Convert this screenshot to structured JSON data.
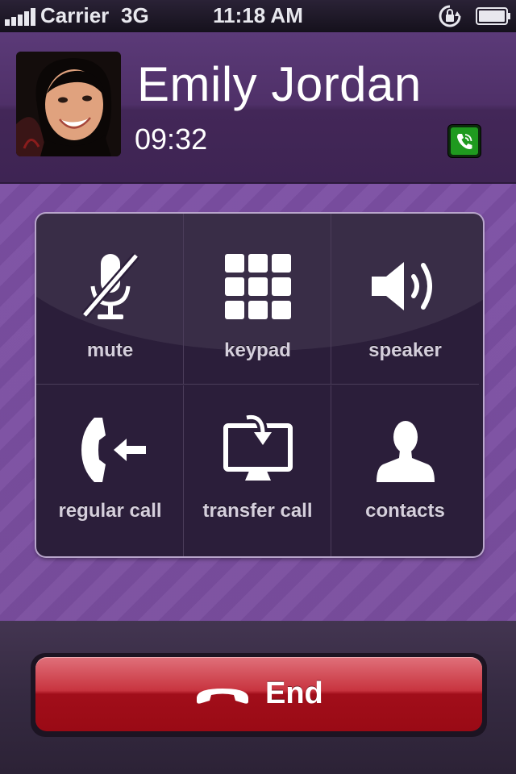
{
  "status_bar": {
    "carrier": "Carrier",
    "network": "3G",
    "time": "11:18 AM",
    "icons": [
      "signal-icon",
      "rotation-lock-icon",
      "battery-icon"
    ]
  },
  "caller": {
    "name": "Emily Jordan",
    "duration": "09:32",
    "badge_icon": "viber-phone-icon"
  },
  "controls": [
    {
      "label": "mute",
      "icon": "mute-icon"
    },
    {
      "label": "keypad",
      "icon": "keypad-icon"
    },
    {
      "label": "speaker",
      "icon": "speaker-icon"
    },
    {
      "label": "regular call",
      "icon": "regular-call-icon"
    },
    {
      "label": "transfer call",
      "icon": "transfer-call-icon"
    },
    {
      "label": "contacts",
      "icon": "contacts-icon"
    }
  ],
  "end_button": {
    "label": "End",
    "icon": "hang-up-icon"
  },
  "colors": {
    "background": "#7a4ea1",
    "header": "#4f3068",
    "panel": "#2b1e3a",
    "end_button": "#b81c28",
    "badge": "#1f8f1f"
  }
}
